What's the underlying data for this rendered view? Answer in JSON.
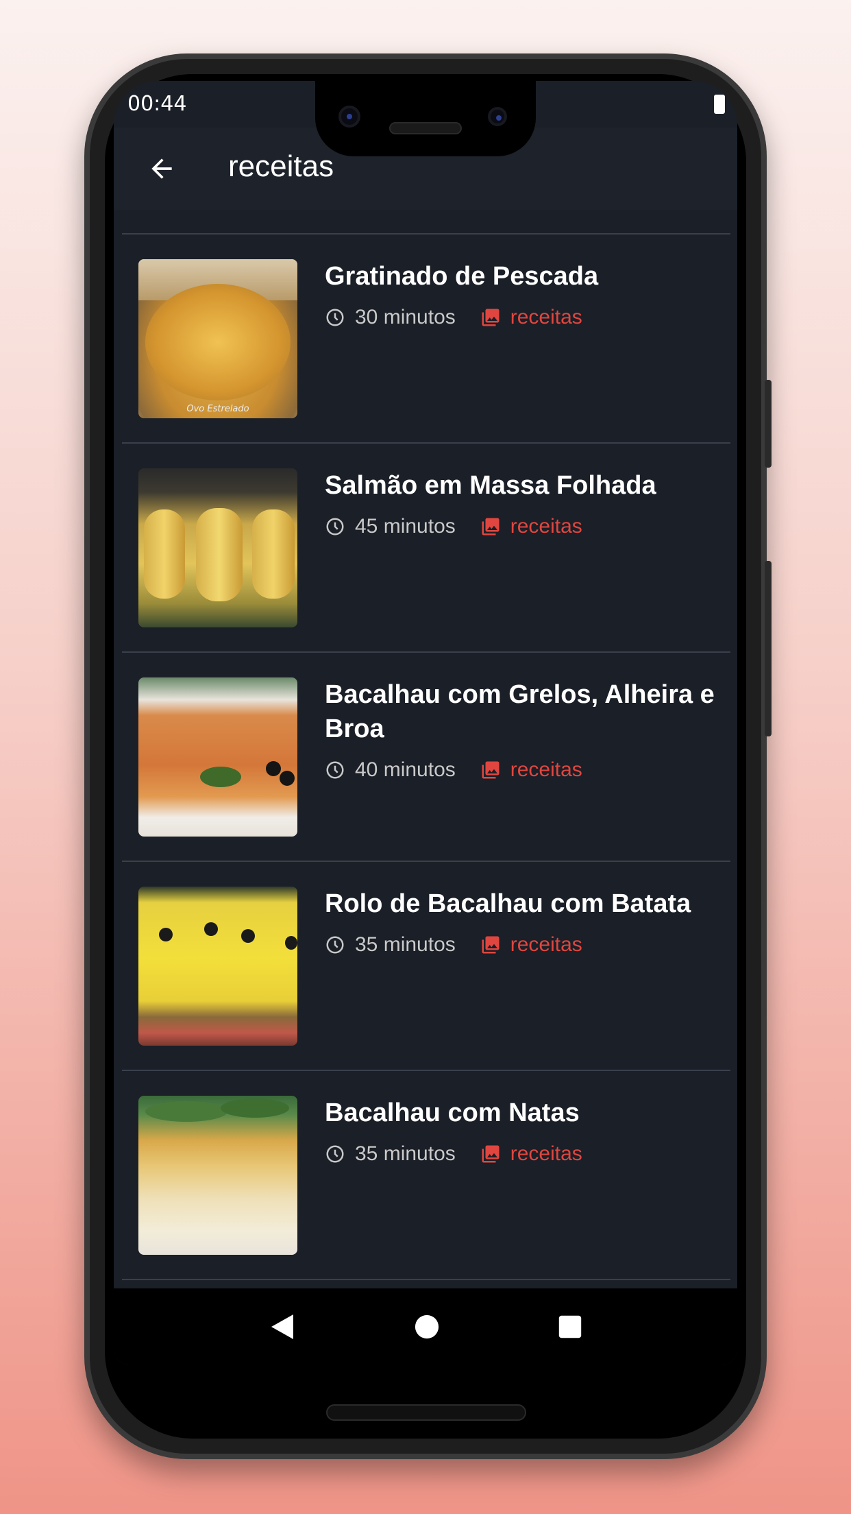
{
  "status": {
    "time": "00:44"
  },
  "appbar": {
    "title": "receitas"
  },
  "recipes": [
    {
      "title": "Gratinado de Pescada",
      "time": "30 minutos",
      "category": "receitas",
      "thumb_watermark": "Ovo Estrelado"
    },
    {
      "title": "Salmão em Massa Folhada",
      "time": "45 minutos",
      "category": "receitas"
    },
    {
      "title": "Bacalhau com Grelos, Alheira e Broa",
      "time": "40 minutos",
      "category": "receitas"
    },
    {
      "title": "Rolo de Bacalhau com Batata",
      "time": "35 minutos",
      "category": "receitas"
    },
    {
      "title": "Bacalhau com Natas",
      "time": "35 minutos",
      "category": "receitas"
    }
  ],
  "colors": {
    "background": "#1b1f27",
    "accent": "#e0463f",
    "text": "#ffffff",
    "muted": "#c9c9c9"
  },
  "icons": {
    "back": "arrow-left-icon",
    "clock": "clock-icon",
    "category": "photo-library-icon",
    "nav": [
      "back-triangle-icon",
      "home-circle-icon",
      "recents-square-icon"
    ]
  }
}
